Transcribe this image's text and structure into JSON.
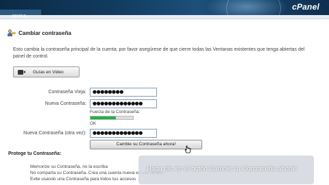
{
  "header": {
    "logo": "cPanel",
    "breadcrumb": "DEMO B"
  },
  "page": {
    "title": "Cambiar contraseña",
    "description": "Esto cambia la contraseña principal de la cuenta; por favor asegúrese de que cierre todas las Ventanas existentes que tenga abiertas del panel de control.",
    "video_button": "Guías en Video"
  },
  "form": {
    "old_password": {
      "label": "Contraseña Vieja:",
      "value": "●●●●●●●●"
    },
    "new_password": {
      "label": "Nueva Contraseña:",
      "value": "●●●●●●●●●●●●●"
    },
    "strength": {
      "label": "Fuerza de la Contraseña:",
      "status": "OK",
      "level": 0.6,
      "color": "#22b14c"
    },
    "confirm_password": {
      "label": "Nueva Contraseña (otra vez):",
      "value": "●●●●●●●●●●●●●"
    },
    "submit": "Cambie su Contraseña ahora!"
  },
  "protect": {
    "title": "Protege tu Contraseña:",
    "tips": [
      "Memorize su Contraseña, no la escriba",
      "No comparta su Contraseña. Crea una cuenta nueva en vez de eso",
      "Evite usando una Contraseña para todos tus accesos"
    ]
  },
  "caption": {
    "text": "Haga clic en el botón Cambie su Contraseña ahora!"
  },
  "icons": {
    "title": "user-key-icon",
    "video": "camera-icon",
    "cursor": "hand-pointer-icon"
  }
}
